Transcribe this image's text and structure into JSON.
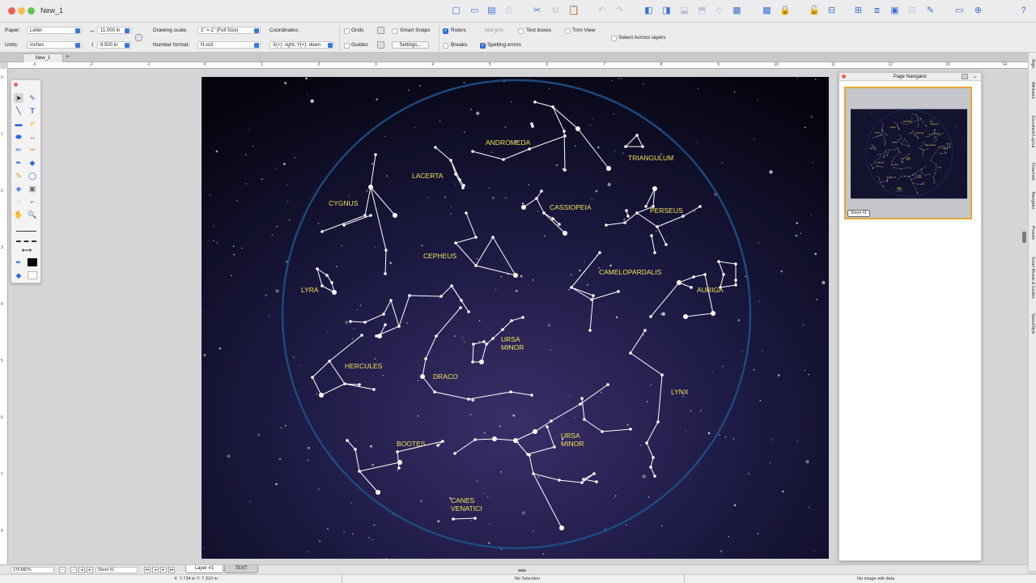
{
  "window": {
    "title": "New_1"
  },
  "colors": {
    "accent": "#3a78d8",
    "navigator_highlight": "#e5a534",
    "label_yellow": "#f2e35a",
    "sky_ring": "#1f4f86"
  },
  "toolbar_icons": [
    "new-document-icon",
    "open-icon",
    "save-icon",
    "print-icon",
    "cut-icon",
    "copy-icon",
    "paste-icon",
    "undo-icon",
    "redo-icon",
    "bring-front-icon",
    "send-back-icon",
    "move-forward-icon",
    "move-backward-icon",
    "flip-icon",
    "group-icon",
    "ungroup-icon",
    "lock-icon",
    "unlock-icon",
    "align-icon",
    "distribute-icon",
    "combine-icon",
    "image-icon",
    "fit-icon",
    "edit-icon",
    "presentation-icon",
    "zoom-icon",
    "help-icon"
  ],
  "props": {
    "paper_label": "Paper:",
    "paper_value": "Letter",
    "units_label": "Units:",
    "units_value": "inches",
    "width_value": "11.000 in",
    "height_value": "8.500 in",
    "drawing_scale_label": "Drawing scale:",
    "drawing_scale_value": "1\" = 1\"   (Full Size)",
    "number_format_label": "Number format:",
    "number_format_value": "N.xx3",
    "coordinates_label": "Coordinates:",
    "coordinates_value": "X(+): right, Y(+): down",
    "grids_label": "Grids",
    "guides_label": "Guides",
    "smart_snaps_label": "Smart Snaps",
    "settings_label": "Settings...",
    "rulers_label": "Rulers",
    "breaks_label": "Breaks",
    "margins_label": "Margins",
    "spelling_label": "Spelling errors",
    "text_boxes_label": "Text boxes",
    "trim_view_label": "Trim View",
    "select_across_label": "Select Across layers"
  },
  "document_tab": "New_1",
  "ruler_numbers": [
    "-3",
    "-2",
    "-1",
    "0",
    "1",
    "2",
    "3",
    "4",
    "5",
    "6",
    "7",
    "8",
    "9",
    "10",
    "11",
    "12",
    "13",
    "14"
  ],
  "vruler_numbers": [
    "0",
    "1",
    "2",
    "3",
    "4",
    "5",
    "6",
    "7",
    "8"
  ],
  "constellations": [
    {
      "name": "ANDROMEDA"
    },
    {
      "name": "TRIANGULUM"
    },
    {
      "name": "LACERTA"
    },
    {
      "name": "CYGNUS"
    },
    {
      "name": "CASSIOPEIA"
    },
    {
      "name": "PERSEUS"
    },
    {
      "name": "CEPHEUS"
    },
    {
      "name": "CAMELOPARDALIS"
    },
    {
      "name": "LYRA"
    },
    {
      "name": "AURIGA"
    },
    {
      "name": "URSA",
      "line2": "MINOR"
    },
    {
      "name": "HERCULES"
    },
    {
      "name": "DRACO"
    },
    {
      "name": "LYNX"
    },
    {
      "name": "BOOTES"
    },
    {
      "name": "URSA",
      "line2": "MINOR"
    },
    {
      "name": "CANES",
      "line2": "VENATICI"
    }
  ],
  "navigator": {
    "title": "Page Navigator",
    "sheet_label": "Sheet #1"
  },
  "side_tabs": [
    "Align",
    "Attributes",
    "Document Layout",
    "Flowchart",
    "Navigator",
    "Presets",
    "Smart Mouse & Guides",
    "SpeedStyle"
  ],
  "bottom": {
    "zoom": "176.682%",
    "sheet": "Sheet #1",
    "layer_tab": "Layer #1",
    "text_tab": "TEXT"
  },
  "status": {
    "coords": "X: 7.734 in   Y: 7.310 in",
    "selection": "No Selection",
    "image_edit": "No image edit data"
  }
}
